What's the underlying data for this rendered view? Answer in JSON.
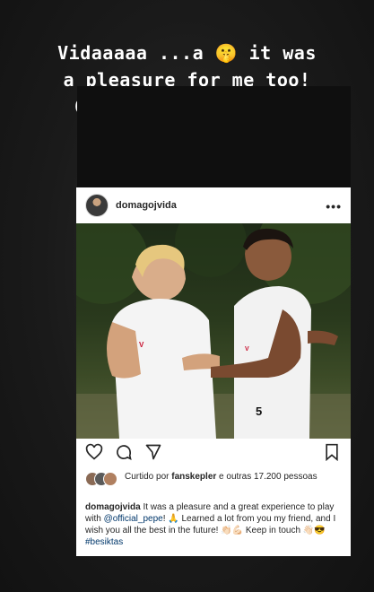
{
  "story": {
    "caption": "Vidaaaaa ...a 🤫  it was\na pleasure for me too!\nGreat player , great\nperson 💯"
  },
  "post": {
    "username": "domagojvida",
    "more_label": "•••",
    "likes": {
      "prefix": "Curtido por ",
      "user": "fanskepler",
      "suffix": " e outras 17.200 pessoas"
    },
    "caption": {
      "user": "domagojvida",
      "text_1": " It was a pleasure and a great experience to play with ",
      "mention": "@official_pepe",
      "text_2": "! 🙏 Learned a lot from you my friend, and I wish you all the best in the future! 👏🏻💪🏻 Keep in touch 👋🏻😎 ",
      "hashtag": "#besiktas"
    },
    "photo": {
      "left_player_shirt_number": "",
      "right_player_shirt_number": "5"
    }
  }
}
